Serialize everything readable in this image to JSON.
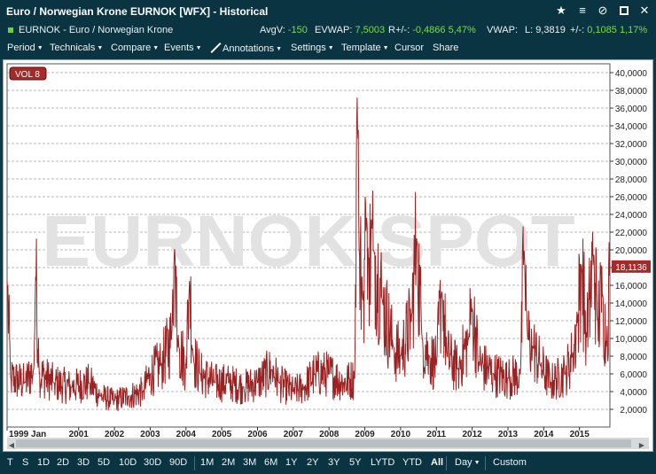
{
  "window": {
    "title": "Euro / Norwegian Krone EURNOK [WFX] - Historical",
    "icons": [
      "star-icon",
      "hamburger-menu-icon",
      "unlink-icon",
      "maximize-icon",
      "close-icon"
    ]
  },
  "info": {
    "symbol": "EURNOK - Euro / Norwegian Krone",
    "avgv_label": "AvgV:",
    "avgv_value": "-150",
    "evwap_label": "EVWAP:",
    "evwap_value": "7,5003",
    "rchg_label": "R+/-:",
    "rchg_value": "-0,4866",
    "rchg_pct": "5,47%",
    "vwap_label": "VWAP:",
    "l_label": "L:",
    "l_value": "9,3819",
    "chg_label": "+/-:",
    "chg_value": "0,1085",
    "chg_pct": "1,17%",
    "accent_green": "#7ddc4a"
  },
  "menu": {
    "period": "Period",
    "technicals": "Technicals",
    "compare": "Compare",
    "events": "Events",
    "annotations": "Annotations",
    "settings": "Settings",
    "template": "Template",
    "cursor": "Cursor",
    "share": "Share"
  },
  "timeframes": [
    "T",
    "S",
    "1D",
    "2D",
    "3D",
    "5D",
    "10D",
    "30D",
    "90D",
    "1M",
    "2M",
    "3M",
    "6M",
    "1Y",
    "2Y",
    "3Y",
    "5Y",
    "LYTD",
    "YTD",
    "All"
  ],
  "active_timeframe": "All",
  "interval": "Day",
  "custom": "Custom",
  "chart_data": {
    "type": "line",
    "indicator_label": "VOL 8",
    "watermark": "EURNOK SPOT",
    "series_color": "#9b2222",
    "last_value_label": "18,1136",
    "last_value": 18114,
    "ylim": [
      0,
      41000
    ],
    "y_ticks": [
      2000,
      4000,
      6000,
      8000,
      10000,
      12000,
      14000,
      16000,
      18000,
      20000,
      22000,
      24000,
      26000,
      28000,
      30000,
      32000,
      34000,
      36000,
      38000,
      40000
    ],
    "y_tick_labels": [
      "2,0000",
      "4,0000",
      "6,0000",
      "8,0000",
      "10,0000",
      "12,0000",
      "14,0000",
      "16,0000",
      "18,0000",
      "20,0000",
      "22,0000",
      "24,0000",
      "26,0000",
      "28,0000",
      "30,0000",
      "32,0000",
      "34,0000",
      "36,0000",
      "38,0000",
      "40,0000"
    ],
    "xlim": [
      1999.0,
      2015.85
    ],
    "x_ticks": [
      1999.0,
      2001,
      2002,
      2003,
      2004,
      2005,
      2006,
      2007,
      2008,
      2009,
      2010,
      2011,
      2012,
      2013,
      2014,
      2015
    ],
    "x_tick_labels": [
      "1999 Jan",
      "2001",
      "2002",
      "2003",
      "2004",
      "2005",
      "2006",
      "2007",
      "2008",
      "2009",
      "2010",
      "2011",
      "2012",
      "2013",
      "2014",
      "2015"
    ],
    "grid": true,
    "anchors": [
      [
        1999.0,
        16500
      ],
      [
        1999.1,
        5500
      ],
      [
        1999.5,
        5000
      ],
      [
        1999.75,
        6500
      ],
      [
        1999.8,
        17500
      ],
      [
        1999.9,
        6000
      ],
      [
        2000.3,
        5000
      ],
      [
        2000.8,
        4500
      ],
      [
        2001.3,
        5000
      ],
      [
        2001.6,
        3500
      ],
      [
        2002.0,
        3000
      ],
      [
        2002.4,
        3500
      ],
      [
        2002.8,
        4000
      ],
      [
        2003.0,
        6000
      ],
      [
        2003.3,
        7000
      ],
      [
        2003.6,
        10000
      ],
      [
        2003.68,
        20500
      ],
      [
        2003.8,
        9000
      ],
      [
        2004.0,
        7000
      ],
      [
        2004.1,
        16500
      ],
      [
        2004.2,
        8000
      ],
      [
        2004.4,
        6000
      ],
      [
        2004.8,
        5000
      ],
      [
        2005.2,
        5000
      ],
      [
        2005.6,
        4500
      ],
      [
        2006.0,
        5000
      ],
      [
        2006.4,
        6500
      ],
      [
        2006.6,
        5000
      ],
      [
        2007.0,
        4000
      ],
      [
        2007.3,
        4500
      ],
      [
        2007.6,
        6000
      ],
      [
        2008.0,
        6000
      ],
      [
        2008.4,
        5000
      ],
      [
        2008.72,
        5500
      ],
      [
        2008.78,
        38500
      ],
      [
        2008.84,
        20000
      ],
      [
        2008.95,
        14000
      ],
      [
        2009.05,
        24000
      ],
      [
        2009.1,
        19000
      ],
      [
        2009.25,
        20000
      ],
      [
        2009.5,
        14000
      ],
      [
        2009.8,
        9000
      ],
      [
        2010.0,
        8000
      ],
      [
        2010.3,
        12000
      ],
      [
        2010.45,
        21500
      ],
      [
        2010.6,
        10000
      ],
      [
        2010.8,
        8000
      ],
      [
        2011.0,
        7000
      ],
      [
        2011.15,
        15500
      ],
      [
        2011.3,
        8000
      ],
      [
        2011.6,
        6500
      ],
      [
        2011.9,
        10000
      ],
      [
        2012.0,
        13500
      ],
      [
        2012.2,
        7000
      ],
      [
        2012.6,
        6000
      ],
      [
        2013.0,
        5500
      ],
      [
        2013.35,
        6000
      ],
      [
        2013.45,
        20500
      ],
      [
        2013.55,
        10000
      ],
      [
        2013.7,
        9000
      ],
      [
        2013.9,
        7000
      ],
      [
        2014.2,
        5000
      ],
      [
        2014.6,
        6000
      ],
      [
        2014.8,
        8000
      ],
      [
        2014.95,
        12000
      ],
      [
        2015.05,
        18500
      ],
      [
        2015.2,
        10000
      ],
      [
        2015.4,
        19500
      ],
      [
        2015.5,
        12000
      ],
      [
        2015.65,
        15000
      ],
      [
        2015.75,
        9000
      ],
      [
        2015.85,
        18114
      ]
    ]
  }
}
